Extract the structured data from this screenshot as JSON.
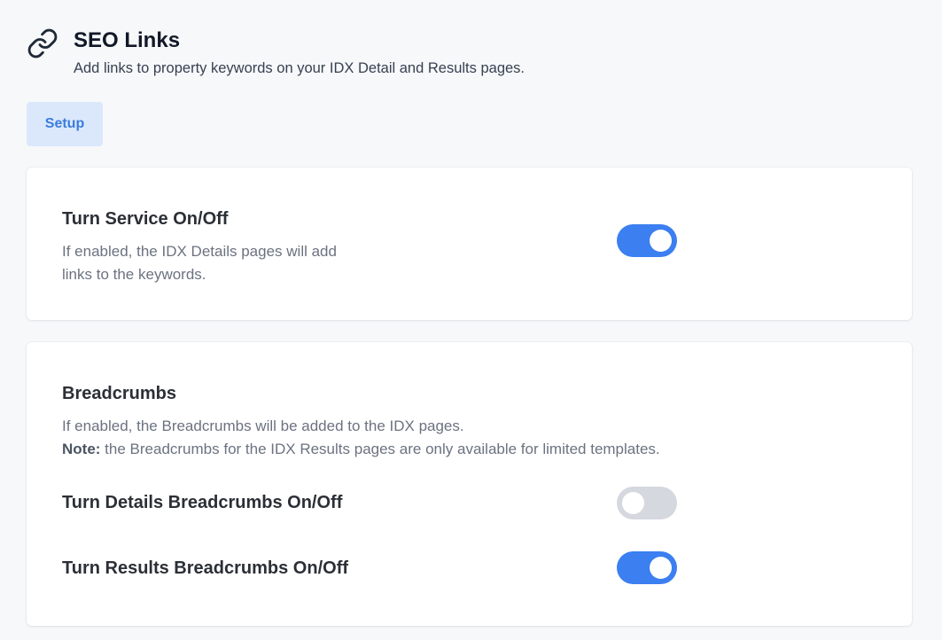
{
  "header": {
    "icon": "link-icon",
    "title": "SEO Links",
    "subtitle": "Add links to property keywords on your IDX Detail and Results pages."
  },
  "tabs": [
    {
      "label": "Setup",
      "active": true
    }
  ],
  "service": {
    "heading": "Turn Service On/Off",
    "description_line1": "If enabled, the IDX Details pages will add",
    "description_line2": "links to the keywords.",
    "toggle_on": true
  },
  "breadcrumbs": {
    "heading": "Breadcrumbs",
    "description": "If enabled, the Breadcrumbs will be added to the IDX pages.",
    "note_label": "Note:",
    "note_text": " the Breadcrumbs for the IDX Results pages are only available for limited templates.",
    "details": {
      "label": "Turn Details Breadcrumbs On/Off",
      "toggle_on": false
    },
    "results": {
      "label": "Turn Results Breadcrumbs On/Off",
      "toggle_on": true
    }
  },
  "colors": {
    "accent": "#3b7ff0",
    "tab_bg": "#dbe8fc",
    "tab_text": "#3b7ddd",
    "toggle_off": "#d5d8de",
    "page_bg": "#f7f8fa"
  }
}
